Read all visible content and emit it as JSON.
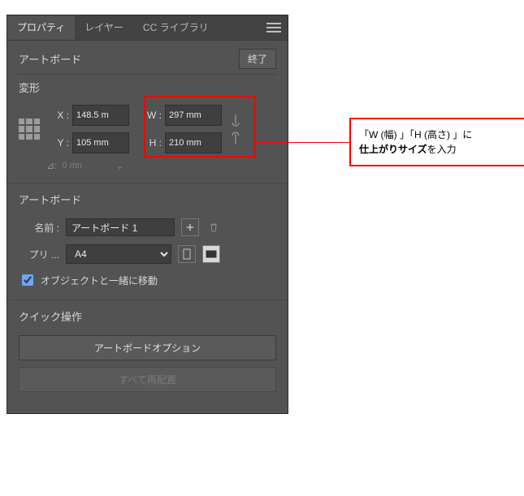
{
  "tabs": {
    "properties": "プロパティ",
    "layers": "レイヤー",
    "cc_libraries": "CC ライブラリ"
  },
  "header": {
    "title": "アートボード",
    "finish": "終了"
  },
  "transform": {
    "title": "変形",
    "x_label": "X :",
    "y_label": "Y :",
    "w_label": "W :",
    "h_label": "H :",
    "x_value": "148.5 m",
    "y_value": "105 mm",
    "w_value": "297 mm",
    "h_value": "210 mm",
    "rot_label": "⊿:",
    "rot_value": "0 mn"
  },
  "artboard": {
    "title": "アートボード",
    "name_label": "名前 :",
    "name_value": "アートボード 1",
    "preset_label": "プリ ...",
    "preset_value": "A4",
    "move_with_objects": "オブジェクトと一緒に移動"
  },
  "quick": {
    "title": "クイック操作",
    "options": "アートボードオプション",
    "redistribute": "すべて再配置"
  },
  "callout": {
    "line1_pre": "「W (幅) 」「H (高さ) 」に",
    "line2_bold": "仕上がりサイズ",
    "line2_post": "を入力"
  }
}
